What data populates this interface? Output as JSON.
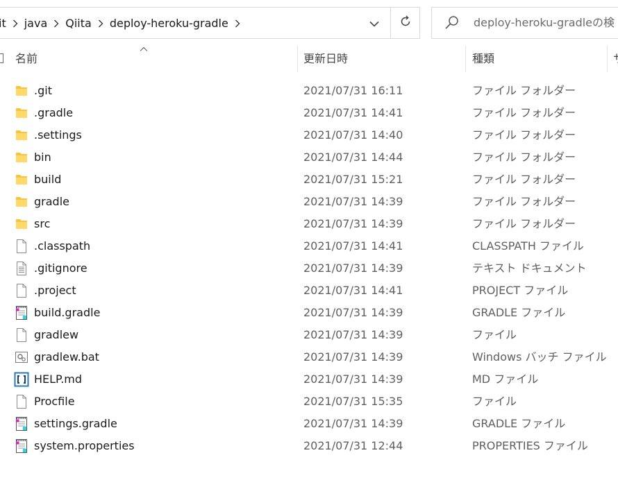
{
  "breadcrumb": [
    "it",
    "java",
    "Qiita",
    "deploy-heroku-gradle"
  ],
  "search": {
    "placeholder": "deploy-heroku-gradleの検"
  },
  "columns": {
    "name": "名前",
    "date": "更新日時",
    "type": "種類",
    "size": "サ"
  },
  "files": [
    {
      "name": ".git",
      "date": "2021/07/31 16:11",
      "type": "ファイル フォルダー",
      "icon": "folder-icon"
    },
    {
      "name": ".gradle",
      "date": "2021/07/31 14:41",
      "type": "ファイル フォルダー",
      "icon": "folder-icon"
    },
    {
      "name": ".settings",
      "date": "2021/07/31 14:40",
      "type": "ファイル フォルダー",
      "icon": "folder-icon"
    },
    {
      "name": "bin",
      "date": "2021/07/31 14:44",
      "type": "ファイル フォルダー",
      "icon": "folder-icon"
    },
    {
      "name": "build",
      "date": "2021/07/31 15:21",
      "type": "ファイル フォルダー",
      "icon": "folder-icon"
    },
    {
      "name": "gradle",
      "date": "2021/07/31 14:39",
      "type": "ファイル フォルダー",
      "icon": "folder-icon"
    },
    {
      "name": "src",
      "date": "2021/07/31 14:39",
      "type": "ファイル フォルダー",
      "icon": "folder-icon"
    },
    {
      "name": ".classpath",
      "date": "2021/07/31 14:41",
      "type": "CLASSPATH ファイル",
      "icon": "file-icon"
    },
    {
      "name": ".gitignore",
      "date": "2021/07/31 14:39",
      "type": "テキスト ドキュメント",
      "icon": "text-file-icon"
    },
    {
      "name": ".project",
      "date": "2021/07/31 14:41",
      "type": "PROJECT ファイル",
      "icon": "file-icon"
    },
    {
      "name": "build.gradle",
      "date": "2021/07/31 14:39",
      "type": "GRADLE ファイル",
      "icon": "notepad-file-icon"
    },
    {
      "name": "gradlew",
      "date": "2021/07/31 14:39",
      "type": "ファイル",
      "icon": "file-icon"
    },
    {
      "name": "gradlew.bat",
      "date": "2021/07/31 14:39",
      "type": "Windows バッチ ファイル",
      "icon": "batch-file-icon"
    },
    {
      "name": "HELP.md",
      "date": "2021/07/31 14:39",
      "type": "MD ファイル",
      "icon": "markdown-file-icon"
    },
    {
      "name": "Procfile",
      "date": "2021/07/31 15:35",
      "type": "ファイル",
      "icon": "file-icon"
    },
    {
      "name": "settings.gradle",
      "date": "2021/07/31 14:39",
      "type": "GRADLE ファイル",
      "icon": "notepad-file-icon"
    },
    {
      "name": "system.properties",
      "date": "2021/07/31 12:44",
      "type": "PROPERTIES ファイル",
      "icon": "notepad-file-icon"
    }
  ]
}
